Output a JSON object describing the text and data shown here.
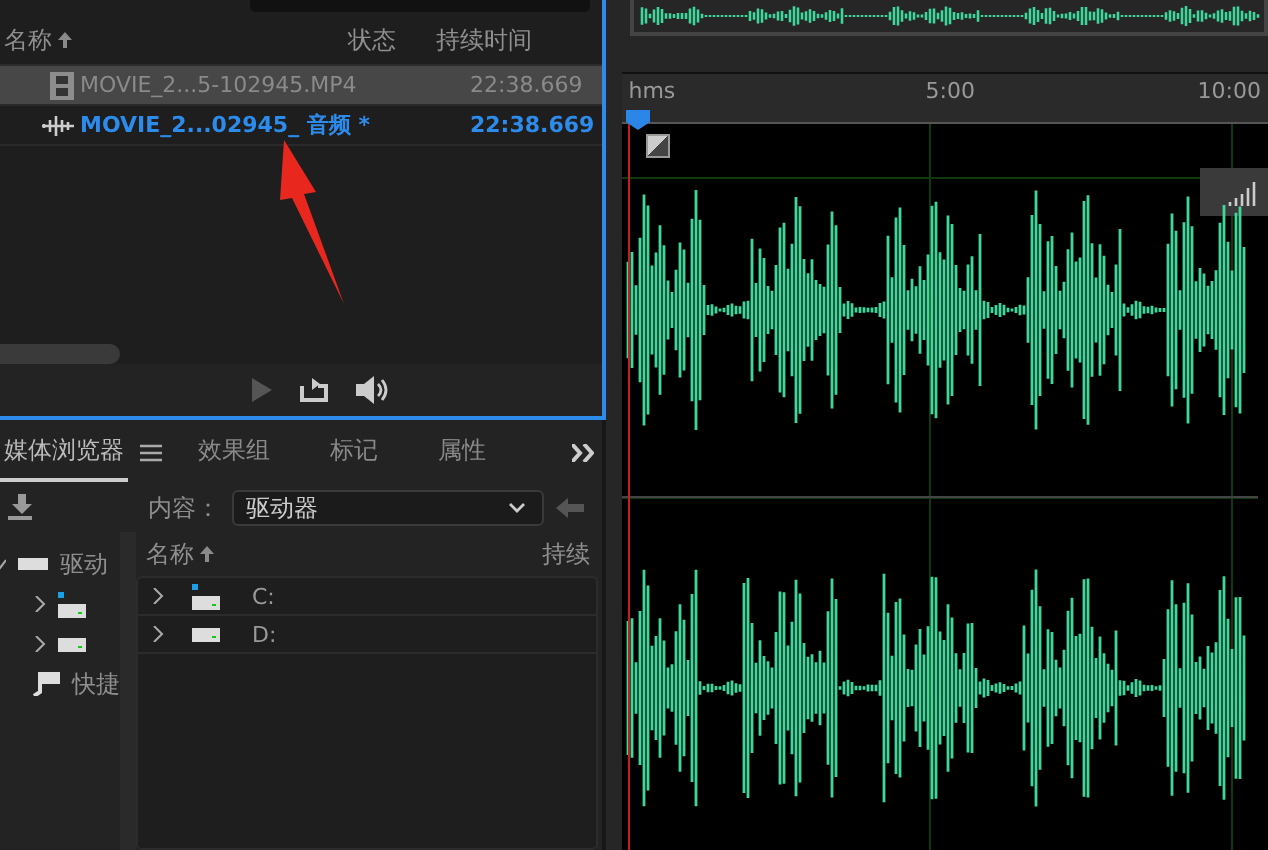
{
  "files_panel": {
    "columns": [
      {
        "label": "名称",
        "sorted": true
      },
      {
        "label": "状态",
        "sorted": false
      },
      {
        "label": "持续时间",
        "sorted": false
      }
    ],
    "rows": [
      {
        "kind": "video",
        "name": "MOVIE_2...5-102945.MP4",
        "duration": "22:38.669",
        "selected": true,
        "open": false
      },
      {
        "kind": "audio",
        "name": "MOVIE_2...02945_ 音频 *",
        "duration": "22:38.669",
        "selected": false,
        "open": true
      }
    ]
  },
  "browser_panel": {
    "tabs": [
      {
        "label": "媒体浏览器",
        "selected": true
      },
      {
        "label": "效果组",
        "selected": false
      },
      {
        "label": "标记",
        "selected": false
      },
      {
        "label": "属性",
        "selected": false
      }
    ],
    "content_label": "内容：",
    "content_value": "驱动器",
    "tree": [
      {
        "label": "驱动",
        "expanded": true,
        "kind": "drives",
        "children": [
          {
            "kind": "system-drive"
          },
          {
            "kind": "drive"
          }
        ]
      },
      {
        "label": "快捷",
        "kind": "shortcut"
      }
    ],
    "columns": [
      {
        "label": "名称",
        "sorted": true
      },
      {
        "label": "持续",
        "sorted": false
      }
    ],
    "drives": [
      {
        "kind": "system-drive",
        "label": "C:"
      },
      {
        "kind": "drive",
        "label": "D:"
      }
    ]
  },
  "editor": {
    "ruler": [
      "hms",
      "5:00",
      "10:00"
    ]
  }
}
